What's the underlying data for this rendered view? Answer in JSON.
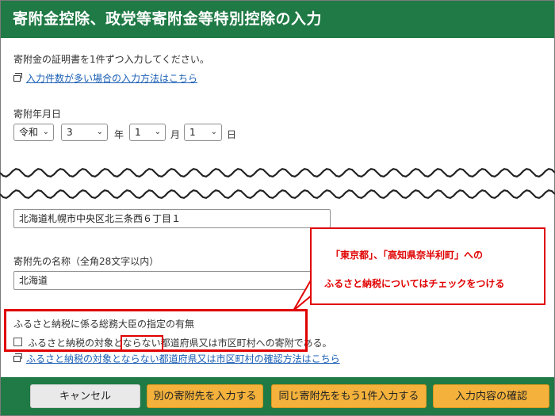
{
  "header": {
    "title": "寄附金控除、政党等寄附金等特別控除の入力"
  },
  "intro": {
    "instruction": "寄附金の証明書を1件ずつ入力してください。",
    "link": "入力件数が多い場合の入力方法はこちら"
  },
  "date": {
    "label": "寄附年月日",
    "era": "令和",
    "year": "3",
    "year_unit": "年",
    "month": "1",
    "month_unit": "月",
    "day": "1",
    "day_unit": "日"
  },
  "address": {
    "value": "北海道札幌市中央区北三条西６丁目１"
  },
  "donee_name": {
    "label": "寄附先の名称（全角28文字以内）",
    "value": "北海道"
  },
  "furusato": {
    "label": "ふるさと納税に係る総務大臣の指定の有無",
    "checkbox_pre": "ふるさと納税の対象と",
    "checkbox_highlight": "ならない",
    "checkbox_post": "都道府県又は市区町村への寄附である。",
    "link": "ふるさと納税の対象とならない都道府県又は市区町村の確認方法はこちら"
  },
  "callout": {
    "line1": "「東京都」、「高知県奈半利町」への",
    "line2": "ふるさと納税についてはチェックをつける"
  },
  "footer": {
    "cancel": "キャンセル",
    "another": "別の寄附先を入力する",
    "same": "同じ寄附先をもう1件入力する",
    "confirm": "入力内容の確認"
  },
  "colors": {
    "header_green": "#1f7a45",
    "button_gold": "#f4b23c",
    "annotation_red": "#e00000"
  }
}
